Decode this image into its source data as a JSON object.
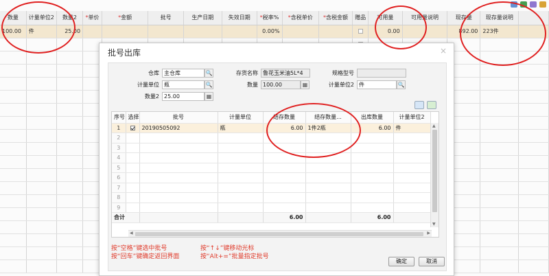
{
  "colors": {
    "accent": "#e02020",
    "selected_row": "#f7ead0",
    "hint": "#e03a2a"
  },
  "background_table": {
    "headers": [
      {
        "label": "数量",
        "required": false
      },
      {
        "label": "计量单位2",
        "required": false
      },
      {
        "label": "数量2",
        "required": false
      },
      {
        "label": "单价",
        "required": true
      },
      {
        "label": "金额",
        "required": true
      },
      {
        "label": "批号",
        "required": false
      },
      {
        "label": "生产日期",
        "required": false
      },
      {
        "label": "失效日期",
        "required": false
      },
      {
        "label": "税率%",
        "required": true
      },
      {
        "label": "含税单价",
        "required": true
      },
      {
        "label": "含税金额",
        "required": true
      },
      {
        "label": "赠品",
        "required": false
      },
      {
        "label": "可用量",
        "required": false
      },
      {
        "label": "可用量说明",
        "required": false
      },
      {
        "label": "现存量",
        "required": false
      },
      {
        "label": "现存量说明",
        "required": false
      }
    ],
    "row": {
      "qty": "100.00",
      "unit2": "件",
      "qty2": "25.00",
      "price": "",
      "amount": "",
      "batch": "",
      "prod_date": "",
      "exp_date": "",
      "tax_rate": "0.00%",
      "tax_price": "",
      "tax_amount": "",
      "gift": "",
      "available": "0.00",
      "available_note": "",
      "stock": "892.00",
      "stock_note": "223件"
    }
  },
  "dialog": {
    "title": "批号出库",
    "close": "×",
    "form": {
      "warehouse_label": "仓库",
      "warehouse_value": "主仓库",
      "unit_label": "计量单位",
      "unit_value": "瓶",
      "qty2_label": "数量2",
      "qty2_value": "25.00",
      "item_name_label": "存货名称",
      "item_name_value": "鲁花玉米油5L*4",
      "qty_label": "数量",
      "qty_value": "100.00",
      "spec_label": "规格型号",
      "spec_value": "",
      "unit2_label": "计量单位2",
      "unit2_value": "件"
    },
    "grid": {
      "headers": [
        "序号",
        "选择",
        "批号",
        "计量单位",
        "结存数量",
        "结存数量...",
        "出库数量",
        "计量单位2"
      ],
      "rows": [
        {
          "no": "1",
          "checked": true,
          "batch": "20190505092",
          "unit": "瓶",
          "balance": "6.00",
          "balance_note": "1件2瓶",
          "out_qty": "6.00",
          "unit2": "件"
        },
        {
          "no": "2"
        },
        {
          "no": "3"
        },
        {
          "no": "4"
        },
        {
          "no": "5"
        },
        {
          "no": "6"
        },
        {
          "no": "7"
        },
        {
          "no": "8"
        },
        {
          "no": "9"
        }
      ],
      "total_label": "合计",
      "total_balance": "6.00",
      "total_out": "6.00"
    },
    "hints": {
      "line1a": "按“空格”键选中批号",
      "line1b": "按“↑↓”键移动光标",
      "line2a": "按“回车”键确定返回界面",
      "line2b": "按“Alt+=”批量指定批号"
    },
    "buttons": {
      "ok": "确定",
      "cancel": "取消"
    }
  }
}
